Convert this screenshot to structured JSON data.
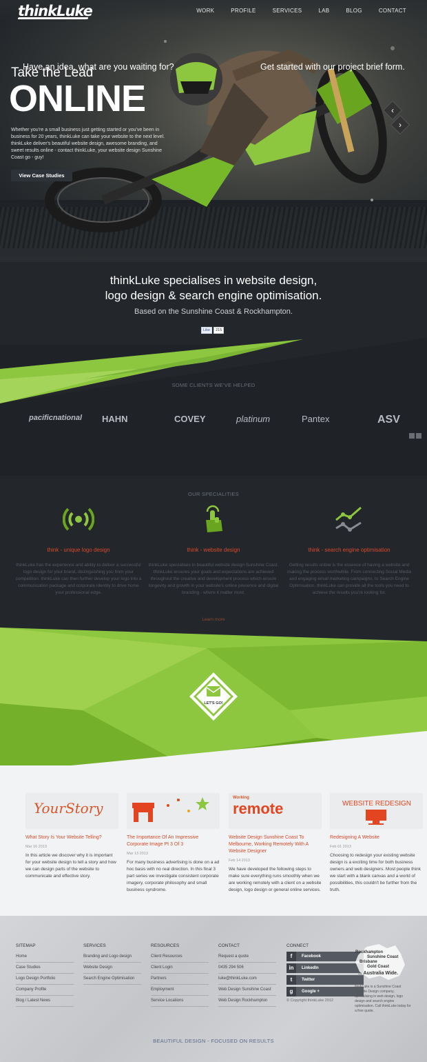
{
  "brand": {
    "logo_text": "thinkLuke"
  },
  "nav": {
    "items": [
      "WORK",
      "PROFILE",
      "SERVICES",
      "LAB",
      "BLOG",
      "CONTACT"
    ]
  },
  "hero": {
    "subtitle": "Take the Lead",
    "title": "ONLINE",
    "text": "Whether you're a small business just getting started or you've been in business for 20 years, thinkLuke can take your website to the next level. thinkLuke deliver's beautiful website design, awesome branding, and sweet results online - contact thinkLuke, your website design Sunshine Coast go - guy!",
    "button": "View Case Studies",
    "prev_arrow": "‹",
    "next_arrow": "›"
  },
  "intro": {
    "headline_1": "thinkLuke specialises in website design,",
    "headline_2": "logo design & search engine optimisation.",
    "location": "Based on the Sunshine Coast & Rockhampton.",
    "fb_like": "Like",
    "fb_count": "215"
  },
  "clients": {
    "heading": "SOME CLIENTS WE'VE HELPED",
    "logos": [
      "pacificnational",
      "HAHN",
      "COVEY",
      "platinum",
      "Pantex",
      "ASV"
    ]
  },
  "specialities": {
    "heading": "OUR SPECIALITIES",
    "items": [
      {
        "title": "think - unique logo design",
        "text": "thinkLuke has the experience and ability to deliver a successful logo design for your brand, distinguishing you from your competition. thinkLuke can then further develop your logo into a communication package and corporate identity to drive home your professional edge."
      },
      {
        "title": "think - website design",
        "text": "thinkLuke specialises in beautiful website design Sunshine Coast. thinkLuke ensures your goals and expectations are achieved throughout the creative and development process which ensure longevity and growth in your website's online presence and digital branding - where it matter most."
      },
      {
        "title": "think - search engine optimisation",
        "text": "Getting results online is the essence of having a website and making the process worthwhile. From connecting Social Media and engaging email marketing campaigns, to Search Engine Optimisation, thinkLuke can provide all the tools you need to achieve the results you're looking for."
      }
    ],
    "learn_more": "Learn more"
  },
  "cta": {
    "left": "Have an idea, what are you waiting for?",
    "right": "Get started with our project brief form.",
    "badge": "LET'S GO!"
  },
  "blog": {
    "posts": [
      {
        "image_text": "YourStory",
        "title": "What Story Is Your Website Telling?",
        "date": "Mar 16 2013",
        "excerpt": "In this article we discover why it is important for your website design to tell a story and how we can design parts of the website to communicate and effective story."
      },
      {
        "image_text": "",
        "title": "The Importance Of An Impressive Corporate Image Pt 3 Of 3",
        "date": "Mar 13 2013",
        "excerpt": "For many business advertising is done on a ad hoc basis with no real direction. In this final 3 part series we investigate consistent corporate imagery, corporate philosophy and small business syndrome."
      },
      {
        "image_text": "remote",
        "image_subtext": "Working",
        "title": "Website Design Sunshine Coast To Melbourne, Working Remotely With A Website Designer",
        "date": "Feb 14 2013",
        "excerpt": "We have developed the following steps to make sure everything runs smoothly when we are working remotely with a client on a website design, logo design or general online services."
      },
      {
        "image_text": "WEBSITE REDESIGN",
        "title": "Redesigning A Website",
        "date": "Feb 01 2013",
        "excerpt": "Choosing to redesign your existing website design is a exciting time for both business owners and web designers. Most people think we start with a blank canvas and a world of possibilities, this couldn't be further from the truth."
      }
    ]
  },
  "footer": {
    "sitemap": {
      "heading": "SITEMAP",
      "items": [
        "Home",
        "Case Studies",
        "Logo Design Portfolio",
        "Company Profile",
        "Blog / Latest News"
      ]
    },
    "services": {
      "heading": "SERVICES",
      "items": [
        "Branding and Logo design",
        "Website Design",
        "Search Engine Optimisation"
      ]
    },
    "resources": {
      "heading": "RESOURCES",
      "items": [
        "Client Resources",
        "Client Login",
        "Partners",
        "Employment",
        "Service Locations"
      ]
    },
    "contact": {
      "heading": "CONTACT",
      "items": [
        "Request a quote",
        "0435 294 506",
        "luke@thinkLuke.com",
        "Web Design Sunshine Coast",
        "Web Design Rockhampton"
      ]
    },
    "connect": {
      "heading": "CONNECT",
      "items": [
        "Facebook",
        "LinkedIn",
        "Twitter",
        "Google +"
      ],
      "copyright": "© Copyright thinkLuke 2012"
    },
    "map": {
      "rockhampton": "Rockhampton",
      "sunshine_coast": "Sunshine Coast",
      "brisbane": "Brisbane",
      "gold_coast": "Gold Coast",
      "australia": "... Australia Wide.",
      "blurb": "thinkLuke is a Sunshine Coast Website Design company, specialising in web design, logo design and search engine optimisation. Call thinkLuke today for a free quote."
    },
    "tagline": "BEAUTIFUL DESIGN - FOCUSED ON RESULTS"
  },
  "colors": {
    "accent_green": "#8dc63f",
    "accent_red": "#d94a2c",
    "dark": "#23262b"
  }
}
